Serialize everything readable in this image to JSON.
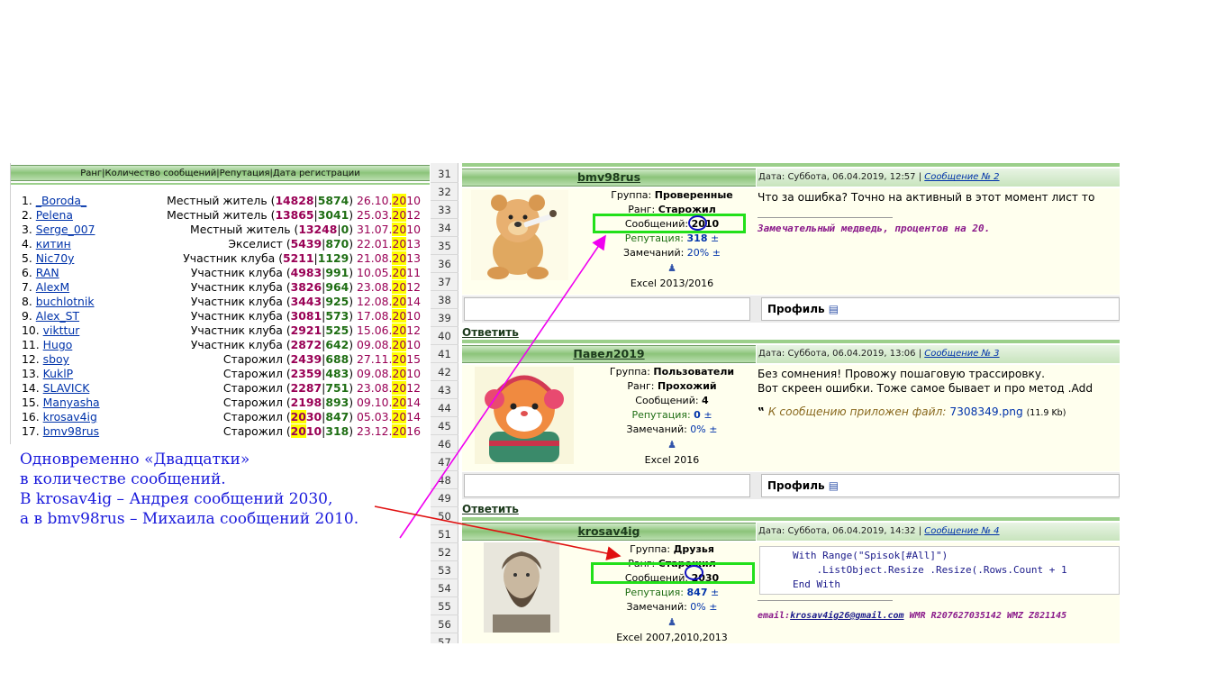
{
  "left_panel": {
    "header": "Ранг|Количество сообщений|Репутация|Дата регистрации",
    "rows": [
      {
        "num": "1.",
        "nick": "_Boroda_",
        "rank": "Местный житель",
        "msgs": "14828",
        "rep": "5874",
        "d1": "26.10.",
        "y1": "20",
        "y2": "10"
      },
      {
        "num": "2.",
        "nick": "Pelena",
        "rank": "Местный житель",
        "msgs": "13865",
        "rep": "3041",
        "d1": "25.03.",
        "y1": "20",
        "y2": "12"
      },
      {
        "num": "3.",
        "nick": "Serge_007",
        "rank": "Местный житель",
        "msgs": "13248",
        "rep": "0",
        "d1": "31.07.",
        "y1": "20",
        "y2": "10"
      },
      {
        "num": "4.",
        "nick": "китин",
        "rank": "Экселист",
        "msgs": "5439",
        "rep": "870",
        "d1": "22.01.",
        "y1": "20",
        "y2": "13"
      },
      {
        "num": "5.",
        "nick": "Nic70y",
        "rank": "Участник клуба",
        "msgs": "5211",
        "rep": "1129",
        "d1": "21.08.",
        "y1": "20",
        "y2": "13"
      },
      {
        "num": "6.",
        "nick": "RAN",
        "rank": "Участник клуба",
        "msgs": "4983",
        "rep": "991",
        "d1": "10.05.",
        "y1": "20",
        "y2": "11"
      },
      {
        "num": "7.",
        "nick": "AlexM",
        "rank": "Участник клуба",
        "msgs": "3826",
        "rep": "964",
        "d1": "23.08.",
        "y1": "20",
        "y2": "12"
      },
      {
        "num": "8.",
        "nick": "buchlotnik",
        "rank": "Участник клуба",
        "msgs": "3443",
        "rep": "925",
        "d1": "12.08.",
        "y1": "20",
        "y2": "14"
      },
      {
        "num": "9.",
        "nick": "Alex_ST",
        "rank": "Участник клуба",
        "msgs": "3081",
        "rep": "573",
        "d1": "17.08.",
        "y1": "20",
        "y2": "10"
      },
      {
        "num": "10.",
        "nick": "vikttur",
        "rank": "Участник клуба",
        "msgs": "2921",
        "rep": "525",
        "d1": "15.06.",
        "y1": "20",
        "y2": "12"
      },
      {
        "num": "11.",
        "nick": "Hugo",
        "rank": "Участник клуба",
        "msgs": "2872",
        "rep": "642",
        "d1": "09.08.",
        "y1": "20",
        "y2": "10"
      },
      {
        "num": "12.",
        "nick": "sboy",
        "rank": "Старожил",
        "msgs": "2439",
        "rep": "688",
        "d1": "27.11.",
        "y1": "20",
        "y2": "15"
      },
      {
        "num": "13.",
        "nick": "KuklP",
        "rank": "Старожил",
        "msgs": "2359",
        "rep": "483",
        "d1": "09.08.",
        "y1": "20",
        "y2": "10"
      },
      {
        "num": "14.",
        "nick": "SLAVICK",
        "rank": "Старожил",
        "msgs": "2287",
        "rep": "751",
        "d1": "23.08.",
        "y1": "20",
        "y2": "12"
      },
      {
        "num": "15.",
        "nick": "Manyasha",
        "rank": "Старожил",
        "msgs": "2198",
        "rep": "893",
        "d1": "09.10.",
        "y1": "20",
        "y2": "14"
      },
      {
        "num": "16.",
        "nick": "krosav4ig",
        "rank": "Старожил",
        "msgs_hl": "20",
        "msgs_rest": "30",
        "rep": "847",
        "d1": "05.03.",
        "y1": "20",
        "y2": "14"
      },
      {
        "num": "17.",
        "nick": "bmv98rus",
        "rank": "Старожил",
        "msgs_hl": "20",
        "msgs_rest": "10",
        "rep": "318",
        "d1": "23.12.",
        "y1": "20",
        "y2": "16"
      }
    ]
  },
  "annotation": {
    "line1": "Одновременно «Двадцатки»",
    "line2": "в количестве сообщений.",
    "line3": "В krosav4ig – Андрея сообщений 2030,",
    "line4": "а в bmv98rus – Михаила сообщений 2010."
  },
  "row_numbers": [
    "31",
    "32",
    "33",
    "34",
    "35",
    "36",
    "37",
    "38",
    "39",
    "40",
    "41",
    "42",
    "43",
    "44",
    "45",
    "46",
    "47",
    "48",
    "49",
    "50",
    "51",
    "52",
    "53",
    "54",
    "55",
    "56",
    "57"
  ],
  "posts": [
    {
      "author": "bmv98rus",
      "date_label": "Дата: Суббота, 06.04.2019, 12:57 |",
      "msg_link": "Сообщение № 2",
      "group_label": "Группа:",
      "group": "Проверенные",
      "rank_label": "Ранг:",
      "rank": "Старожил",
      "msgs_label": "Сообщений:",
      "msgs": "2010",
      "rep_label": "Репутация:",
      "rep": "318",
      "pm": "±",
      "warn_label": "Замечаний:",
      "warn": " 20%",
      "software": "Excel 2013/2016",
      "text1": "Что за ошибка? Точно на активный в этот момент лист то",
      "signature": "Замечательный медведь, процентов на 20.",
      "profile": "Профиль",
      "reply": "Ответить"
    },
    {
      "author": "Павел2019",
      "date_label": "Дата: Суббота, 06.04.2019, 13:06 |",
      "msg_link": "Сообщение № 3",
      "group_label": "Группа:",
      "group": "Пользователи",
      "rank_label": "Ранг:",
      "rank": "Прохожий",
      "msgs_label": "Сообщений:",
      "msgs": "4",
      "rep_label": "Репутация:",
      "rep": "0",
      "pm": "±",
      "warn_label": "Замечаний:",
      "warn": " 0%",
      "software": "Excel 2016",
      "text1": "Без сомнения! Провожу пошаговую трассировку.",
      "text2": "Вот скреен ошибки. Тоже самое бывает и про метод .Add",
      "attach_label": "К сообщению приложен файл:",
      "attach_file": "7308349.png",
      "attach_size": "(11.9 Kb)",
      "profile": "Профиль",
      "reply": "Ответить"
    },
    {
      "author": "krosav4ig",
      "date_label": "Дата: Суббота, 06.04.2019, 14:32 |",
      "msg_link": "Сообщение № 4",
      "group_label": "Группа:",
      "group": "Друзья",
      "rank_label": "Ранг:",
      "rank": "Старожил",
      "msgs_label": "Сообщений:",
      "msgs": "2030",
      "rep_label": "Репутация:",
      "rep": "847",
      "pm": "±",
      "warn_label": "Замечаний:",
      "warn": " 0%",
      "software": "Excel 2007,2010,2013",
      "code1": "With Range(\"Spisok[#All]\")",
      "code2": "    .ListObject.Resize .Resize(.Rows.Count + 1",
      "code3": "End With",
      "sig_email_label": "email:",
      "sig_email": "krosav4ig26@gmail.com",
      "sig_rest": "WMR R207627035142 WMZ Z821145"
    }
  ],
  "colors": {
    "green_box": "#22e01a",
    "circle": "#1010c0",
    "arrow_red": "#e01010",
    "arrow_magenta": "#f000f0",
    "annotation": "#1a1adc",
    "highlight": "#ffff00"
  }
}
